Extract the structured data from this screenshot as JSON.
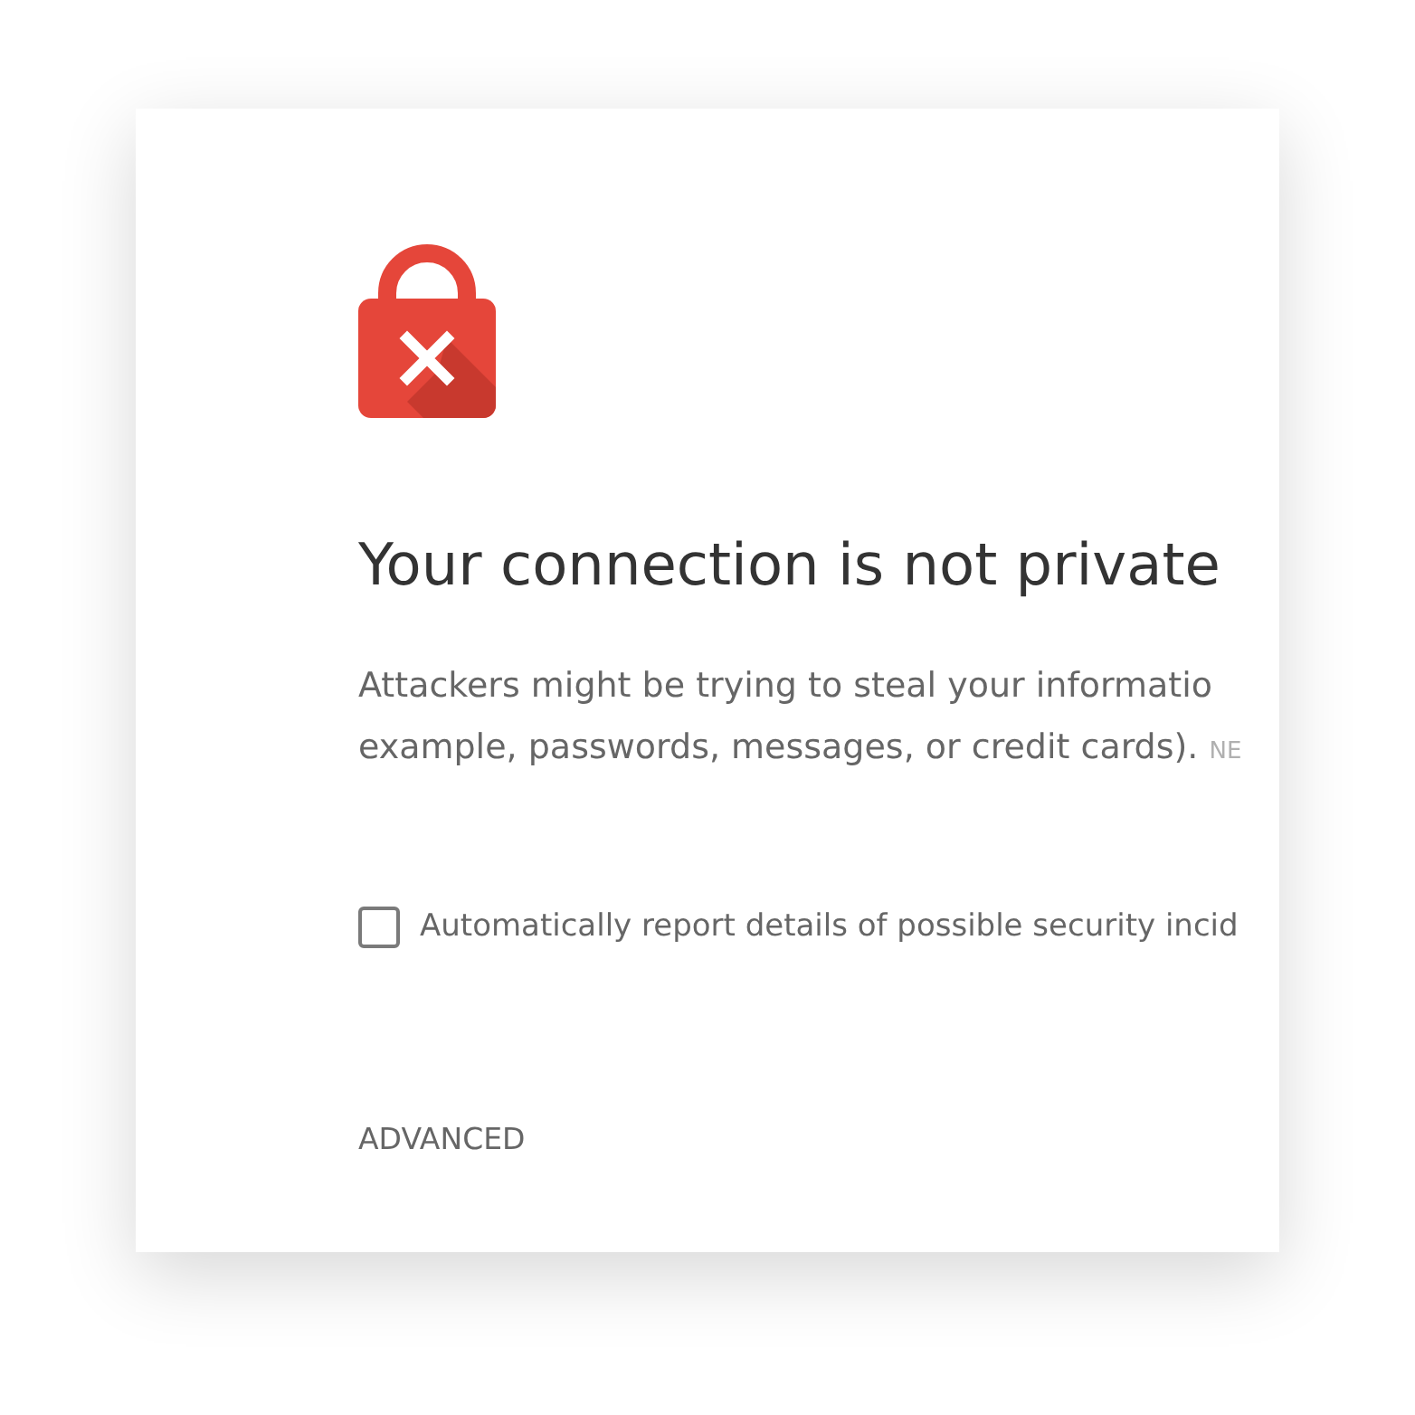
{
  "heading": "Your connection is not private",
  "message": {
    "lines": [
      "Attackers might be trying to steal your informatio",
      "example, passwords, messages, or credit cards)."
    ],
    "error_code": "NE"
  },
  "report_option": {
    "label": "Automatically report details of possible security incid",
    "checked": false
  },
  "advanced_link": "ADVANCED"
}
